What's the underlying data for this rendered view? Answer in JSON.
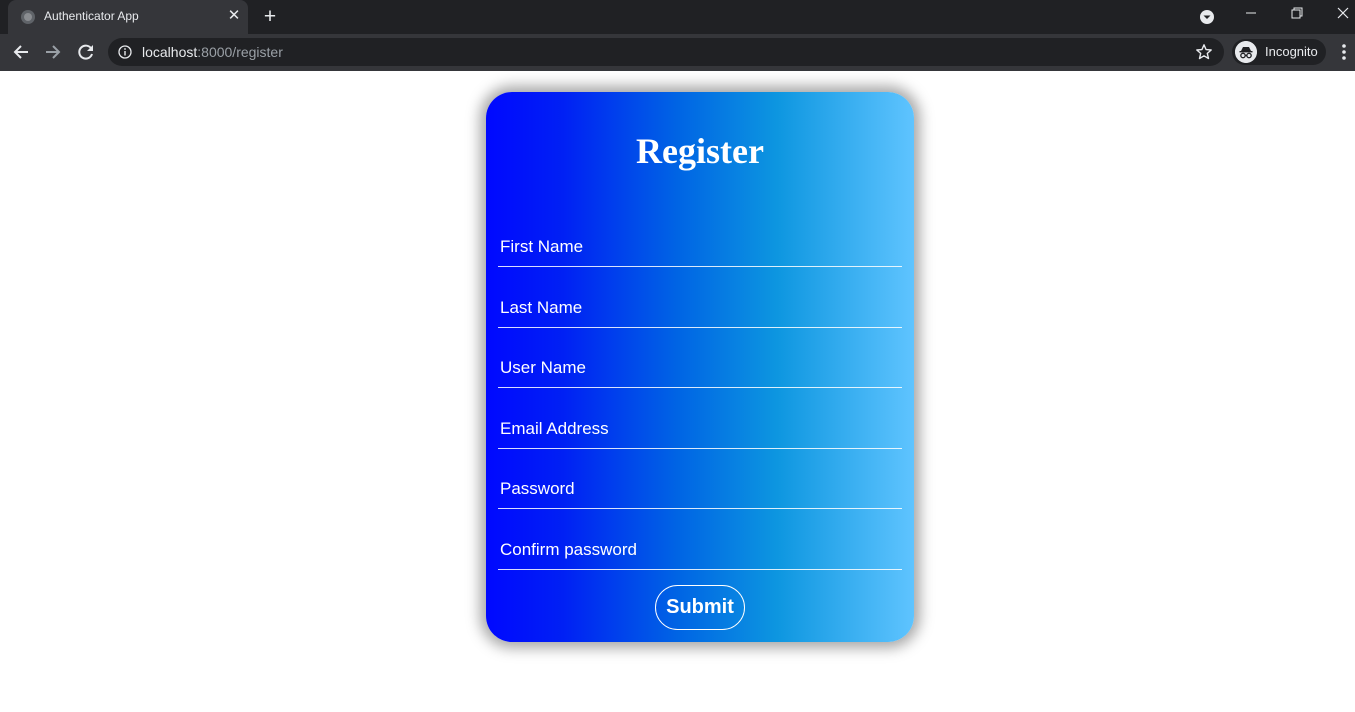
{
  "browser": {
    "tab_title": "Authenticator App",
    "url_host": "localhost",
    "url_path": ":8000/register",
    "profile_label": "Incognito"
  },
  "form": {
    "title": "Register",
    "fields": [
      {
        "placeholder": "First Name",
        "value": ""
      },
      {
        "placeholder": "Last Name",
        "value": ""
      },
      {
        "placeholder": "User Name",
        "value": ""
      },
      {
        "placeholder": "Email Address",
        "value": ""
      },
      {
        "placeholder": "Password",
        "value": ""
      },
      {
        "placeholder": "Confirm password",
        "value": ""
      }
    ],
    "submit_label": "Submit",
    "gradient_colors": [
      "#0008ff",
      "#0065e4",
      "#0d96e0",
      "#5fc4ff"
    ]
  }
}
